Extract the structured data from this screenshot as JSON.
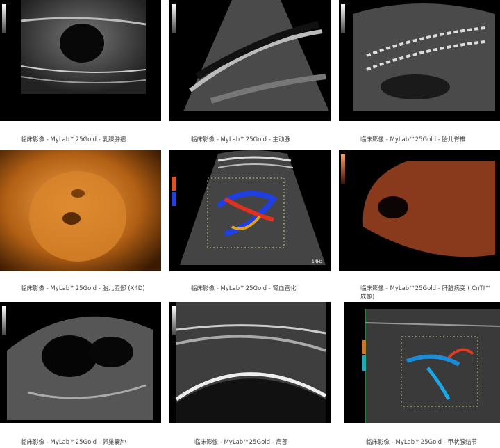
{
  "gallery": {
    "items": [
      {
        "caption": "临床影像 - MyLab™25Gold - 乳腺肿瘤",
        "image": "breast-tumor"
      },
      {
        "caption": "临床影像 - MyLab™25Gold - 主动脉",
        "image": "aorta"
      },
      {
        "caption": "临床影像 - MyLab™25Gold - 胎儿脊椎",
        "image": "fetal-spine"
      },
      {
        "caption": "临床影像 - MyLab™25Gold - 胎儿脸部 (X4D)",
        "image": "fetal-face-4d"
      },
      {
        "caption": "临床影像 - MyLab™25Gold - 肾血管化",
        "image": "kidney-vascularization"
      },
      {
        "caption": "临床影像 - MyLab™25Gold - 肝脏病变 ( CnTI™ 成像)",
        "image": "liver-lesion"
      },
      {
        "caption": "临床影像 - MyLab™25Gold - 卵巢囊肿",
        "image": "ovarian-cyst"
      },
      {
        "caption": "临床影像 - MyLab™25Gold - 肩部",
        "image": "shoulder"
      },
      {
        "caption": "临床影像 - MyLab™25Gold - 甲状腺结节",
        "image": "thyroid-nodule"
      }
    ],
    "overlay_text": {
      "freq": "14Hz"
    }
  }
}
